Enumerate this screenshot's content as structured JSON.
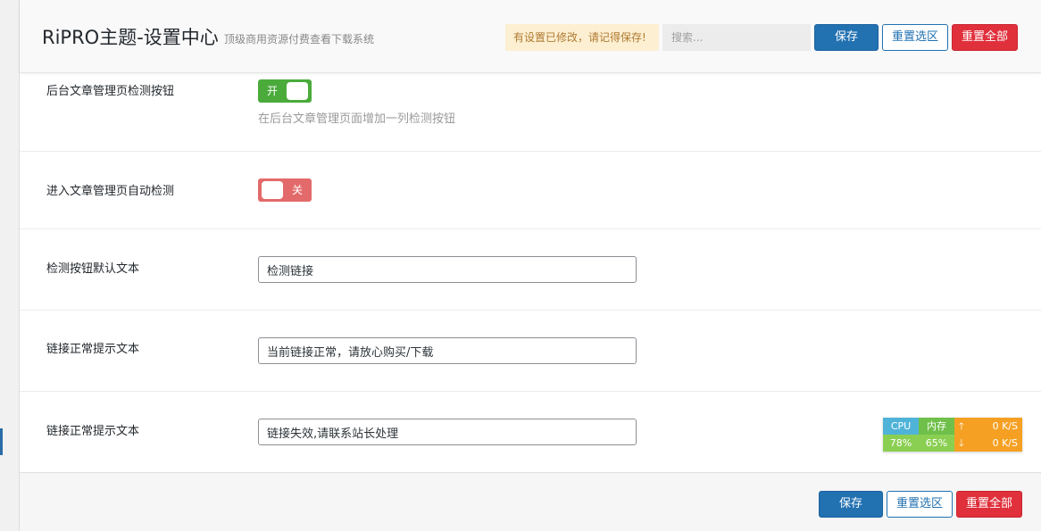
{
  "header": {
    "title": "RiPRO主题-设置中心",
    "subtitle": "顶级商用资源付费查看下载系统",
    "notice": "有设置已修改，请记得保存!",
    "search_placeholder": "搜索...",
    "save_label": "保存",
    "reset_section_label": "重置选区",
    "reset_all_label": "重置全部"
  },
  "rows": [
    {
      "label": "后台文章管理页检测按钮",
      "type": "switch",
      "state": "on",
      "switch_text": "开",
      "description": "在后台文章管理页面增加一列检测按钮"
    },
    {
      "label": "进入文章管理页自动检测",
      "type": "switch",
      "state": "off",
      "switch_text": "关"
    },
    {
      "label": "检测按钮默认文本",
      "type": "text",
      "value": "检测链接"
    },
    {
      "label": "链接正常提示文本",
      "type": "text",
      "value": "当前链接正常，请放心购买/下载"
    },
    {
      "label": "链接正常提示文本",
      "type": "text",
      "value": "链接失效,请联系站长处理"
    }
  ],
  "footer": {
    "save_label": "保存",
    "reset_section_label": "重置选区",
    "reset_all_label": "重置全部"
  },
  "monitor": {
    "cpu_label": "CPU",
    "mem_label": "内存",
    "cpu_value": "78%",
    "mem_value": "65%",
    "up_arrow": "🡑",
    "down_arrow": "🡓",
    "up_speed": "0 K/S",
    "down_speed": "0 K/S"
  },
  "colors": {
    "primary": "#2271b1",
    "danger": "#e0303c",
    "switch_on": "#4aab3b",
    "switch_off": "#e36a6a",
    "notice_bg": "#fcefd2"
  }
}
